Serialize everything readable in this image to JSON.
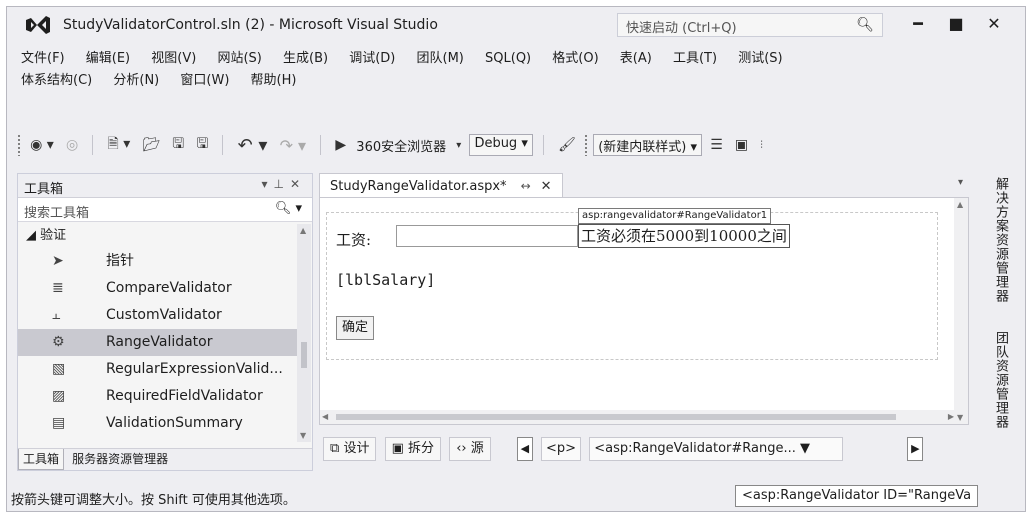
{
  "window": {
    "title": "StudyValidatorControl.sln (2) - Microsoft Visual Studio",
    "quick_launch_placeholder": "快速启动 (Ctrl+Q)",
    "controls": [
      "minimize",
      "maximize",
      "close"
    ]
  },
  "menu": {
    "row1": [
      "文件(F)",
      "编辑(E)",
      "视图(V)",
      "网站(S)",
      "生成(B)",
      "调试(D)",
      "团队(M)",
      "SQL(Q)",
      "格式(O)",
      "表(A)",
      "工具(T)",
      "测试(S)"
    ],
    "row2": [
      "体系结构(C)",
      "分析(N)",
      "窗口(W)",
      "帮助(H)"
    ]
  },
  "toolbar": {
    "browser": "360安全浏览器",
    "configuration": "Debug",
    "style_combo": "(新建内联样式)"
  },
  "toolbox": {
    "title": "工具箱",
    "search_placeholder": "搜索工具箱",
    "group": "◢ 验证",
    "items": [
      {
        "label": "指针",
        "icon": "pointer-icon"
      },
      {
        "label": "CompareValidator",
        "icon": "compare-validator-icon"
      },
      {
        "label": "CustomValidator",
        "icon": "custom-validator-icon"
      },
      {
        "label": "RangeValidator",
        "icon": "range-validator-icon",
        "selected": true
      },
      {
        "label": "RegularExpressionValid...",
        "icon": "regex-validator-icon"
      },
      {
        "label": "RequiredFieldValidator",
        "icon": "required-field-validator-icon"
      },
      {
        "label": "ValidationSummary",
        "icon": "validation-summary-icon"
      }
    ],
    "tabs": [
      "工具箱",
      "服务器资源管理器"
    ]
  },
  "editor": {
    "tab_title": "StudyRangeValidator.aspx*",
    "control_tag": "asp:rangevalidator#RangeValidator1",
    "salary_label": "工资:",
    "validator_message": "工资必须在5000到10000之间",
    "lbl_salary": "[lblSalary]",
    "confirm_button": "确定",
    "views": {
      "design": "设计",
      "split": "拆分",
      "source": "源"
    },
    "breadcrumb_p": "<p>",
    "breadcrumb_control": "<asp:RangeValidator#Range..."
  },
  "side_tabs": [
    "解决方案资源管理器",
    "团队资源管理器"
  ],
  "status": {
    "text": "按箭头键可调整大小。按 Shift 可使用其他选项。",
    "tooltip": "<asp:RangeValidator ID=\"RangeVa"
  }
}
